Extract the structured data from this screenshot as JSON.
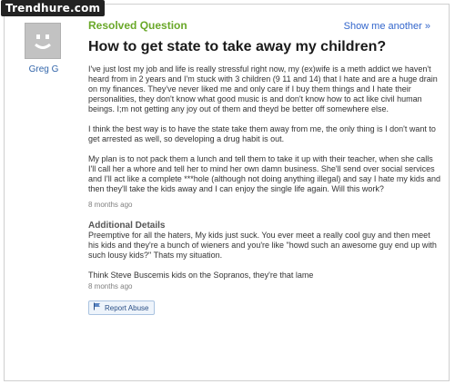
{
  "watermark": "Trendhure.com",
  "asker": {
    "name": "Greg G",
    "avatar": "default-face-avatar"
  },
  "header": {
    "status": "Resolved Question",
    "show_another": "Show me another »"
  },
  "question": {
    "title": "How to get state to take away my children?",
    "paragraphs": [
      "I've just lost my job and life is really stressful right now, my (ex)wife is a meth addict we haven't heard from in 2 years and I'm stuck with 3 children (9 11 and 14) that I hate and are a huge drain on my finances. They've never liked me and only care if I buy them things and I hate their personalities, they don't know what good music is and don't know how to act like civil human beings. I;m not getting any joy out of them and theyd be better off somewhere else.",
      "I think the best way is to have the state take them away from me, the only thing is I don't want to get arrested as well, so developing a drug habit is out.",
      "My plan is to not pack them a lunch and tell them to take it up with their teacher, when she calls I'll call her a whore and tell her to mind her own damn business. She'll send over social services and I'll act like a complete ***hole (although not doing anything illegal) and say I hate my kids and then they'll take the kids away and I can enjoy the single life again. Will this work?"
    ],
    "posted": "8 months ago"
  },
  "additional": {
    "label": "Additional Details",
    "paragraphs": [
      "Preemptive for all the haters, My kids just suck. You ever meet a really cool guy and then meet his kids and they're a bunch of wieners and you're like \"howd such an awesome guy end up with such lousy kids?\" Thats my situation.",
      "Think Steve Buscemis kids on the Sopranos, they're that lame"
    ],
    "posted": "8 months ago"
  },
  "report": {
    "label": "Report Abuse",
    "icon": "flag-icon"
  },
  "colors": {
    "resolved": "#6aa829",
    "link": "#3366cc",
    "report_bg": "#eef4fb"
  }
}
